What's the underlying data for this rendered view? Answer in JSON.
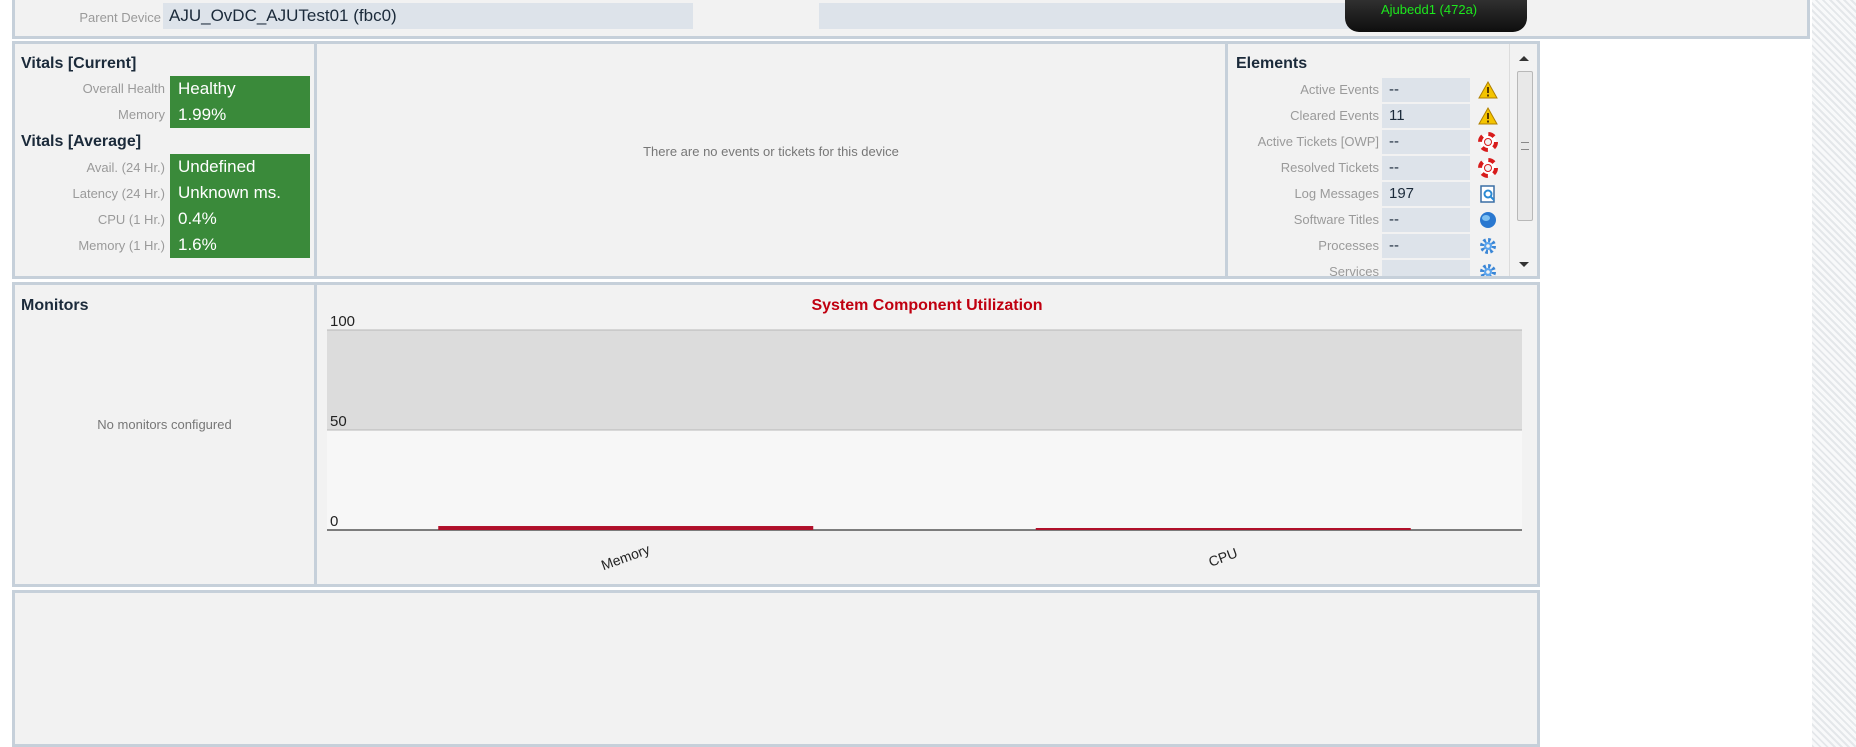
{
  "parent_device": {
    "label": "Parent Device",
    "value": "AJU_OvDC_AJUTest01 (fbc0)",
    "badge_text": "Ajubedd1 (472a)"
  },
  "vitals_current": {
    "heading": "Vitals [Current]",
    "rows": [
      {
        "label": "Overall Health",
        "value": "Healthy"
      },
      {
        "label": "Memory",
        "value": "1.99%"
      }
    ]
  },
  "vitals_average": {
    "heading": "Vitals [Average]",
    "rows": [
      {
        "label": "Avail. (24 Hr.)",
        "value": "Undefined"
      },
      {
        "label": "Latency (24 Hr.)",
        "value": "Unknown ms."
      },
      {
        "label": "CPU (1 Hr.)",
        "value": "0.4%"
      },
      {
        "label": "Memory (1 Hr.)",
        "value": "1.6%"
      }
    ]
  },
  "events_message": "There are no events or tickets for this device",
  "elements": {
    "heading": "Elements",
    "rows": [
      {
        "label": "Active Events",
        "value": "--",
        "icon": "warning-icon"
      },
      {
        "label": "Cleared Events",
        "value": "11",
        "icon": "warning-icon"
      },
      {
        "label": "Active Tickets [OWP]",
        "value": "--",
        "icon": "lifebuoy-icon"
      },
      {
        "label": "Resolved Tickets",
        "value": "--",
        "icon": "lifebuoy-icon"
      },
      {
        "label": "Log Messages",
        "value": "197",
        "icon": "log-document-icon"
      },
      {
        "label": "Software Titles",
        "value": "--",
        "icon": "globe-icon"
      },
      {
        "label": "Processes",
        "value": "--",
        "icon": "gear-icon"
      },
      {
        "label": "Services",
        "value": "",
        "icon": "gear-icon"
      }
    ]
  },
  "monitors": {
    "heading": "Monitors",
    "empty_text": "No monitors configured"
  },
  "colors": {
    "healthy_green": "#3a8a3a",
    "chart_title_red": "#c00010",
    "bar_red": "#b0102a"
  },
  "chart_data": {
    "type": "bar",
    "title": "System Component Utilization",
    "categories": [
      "Memory",
      "CPU"
    ],
    "values": [
      1.99,
      0.4
    ],
    "ylim": [
      0,
      100
    ],
    "yticks": [
      "0",
      "50",
      "100"
    ],
    "grid": true
  }
}
